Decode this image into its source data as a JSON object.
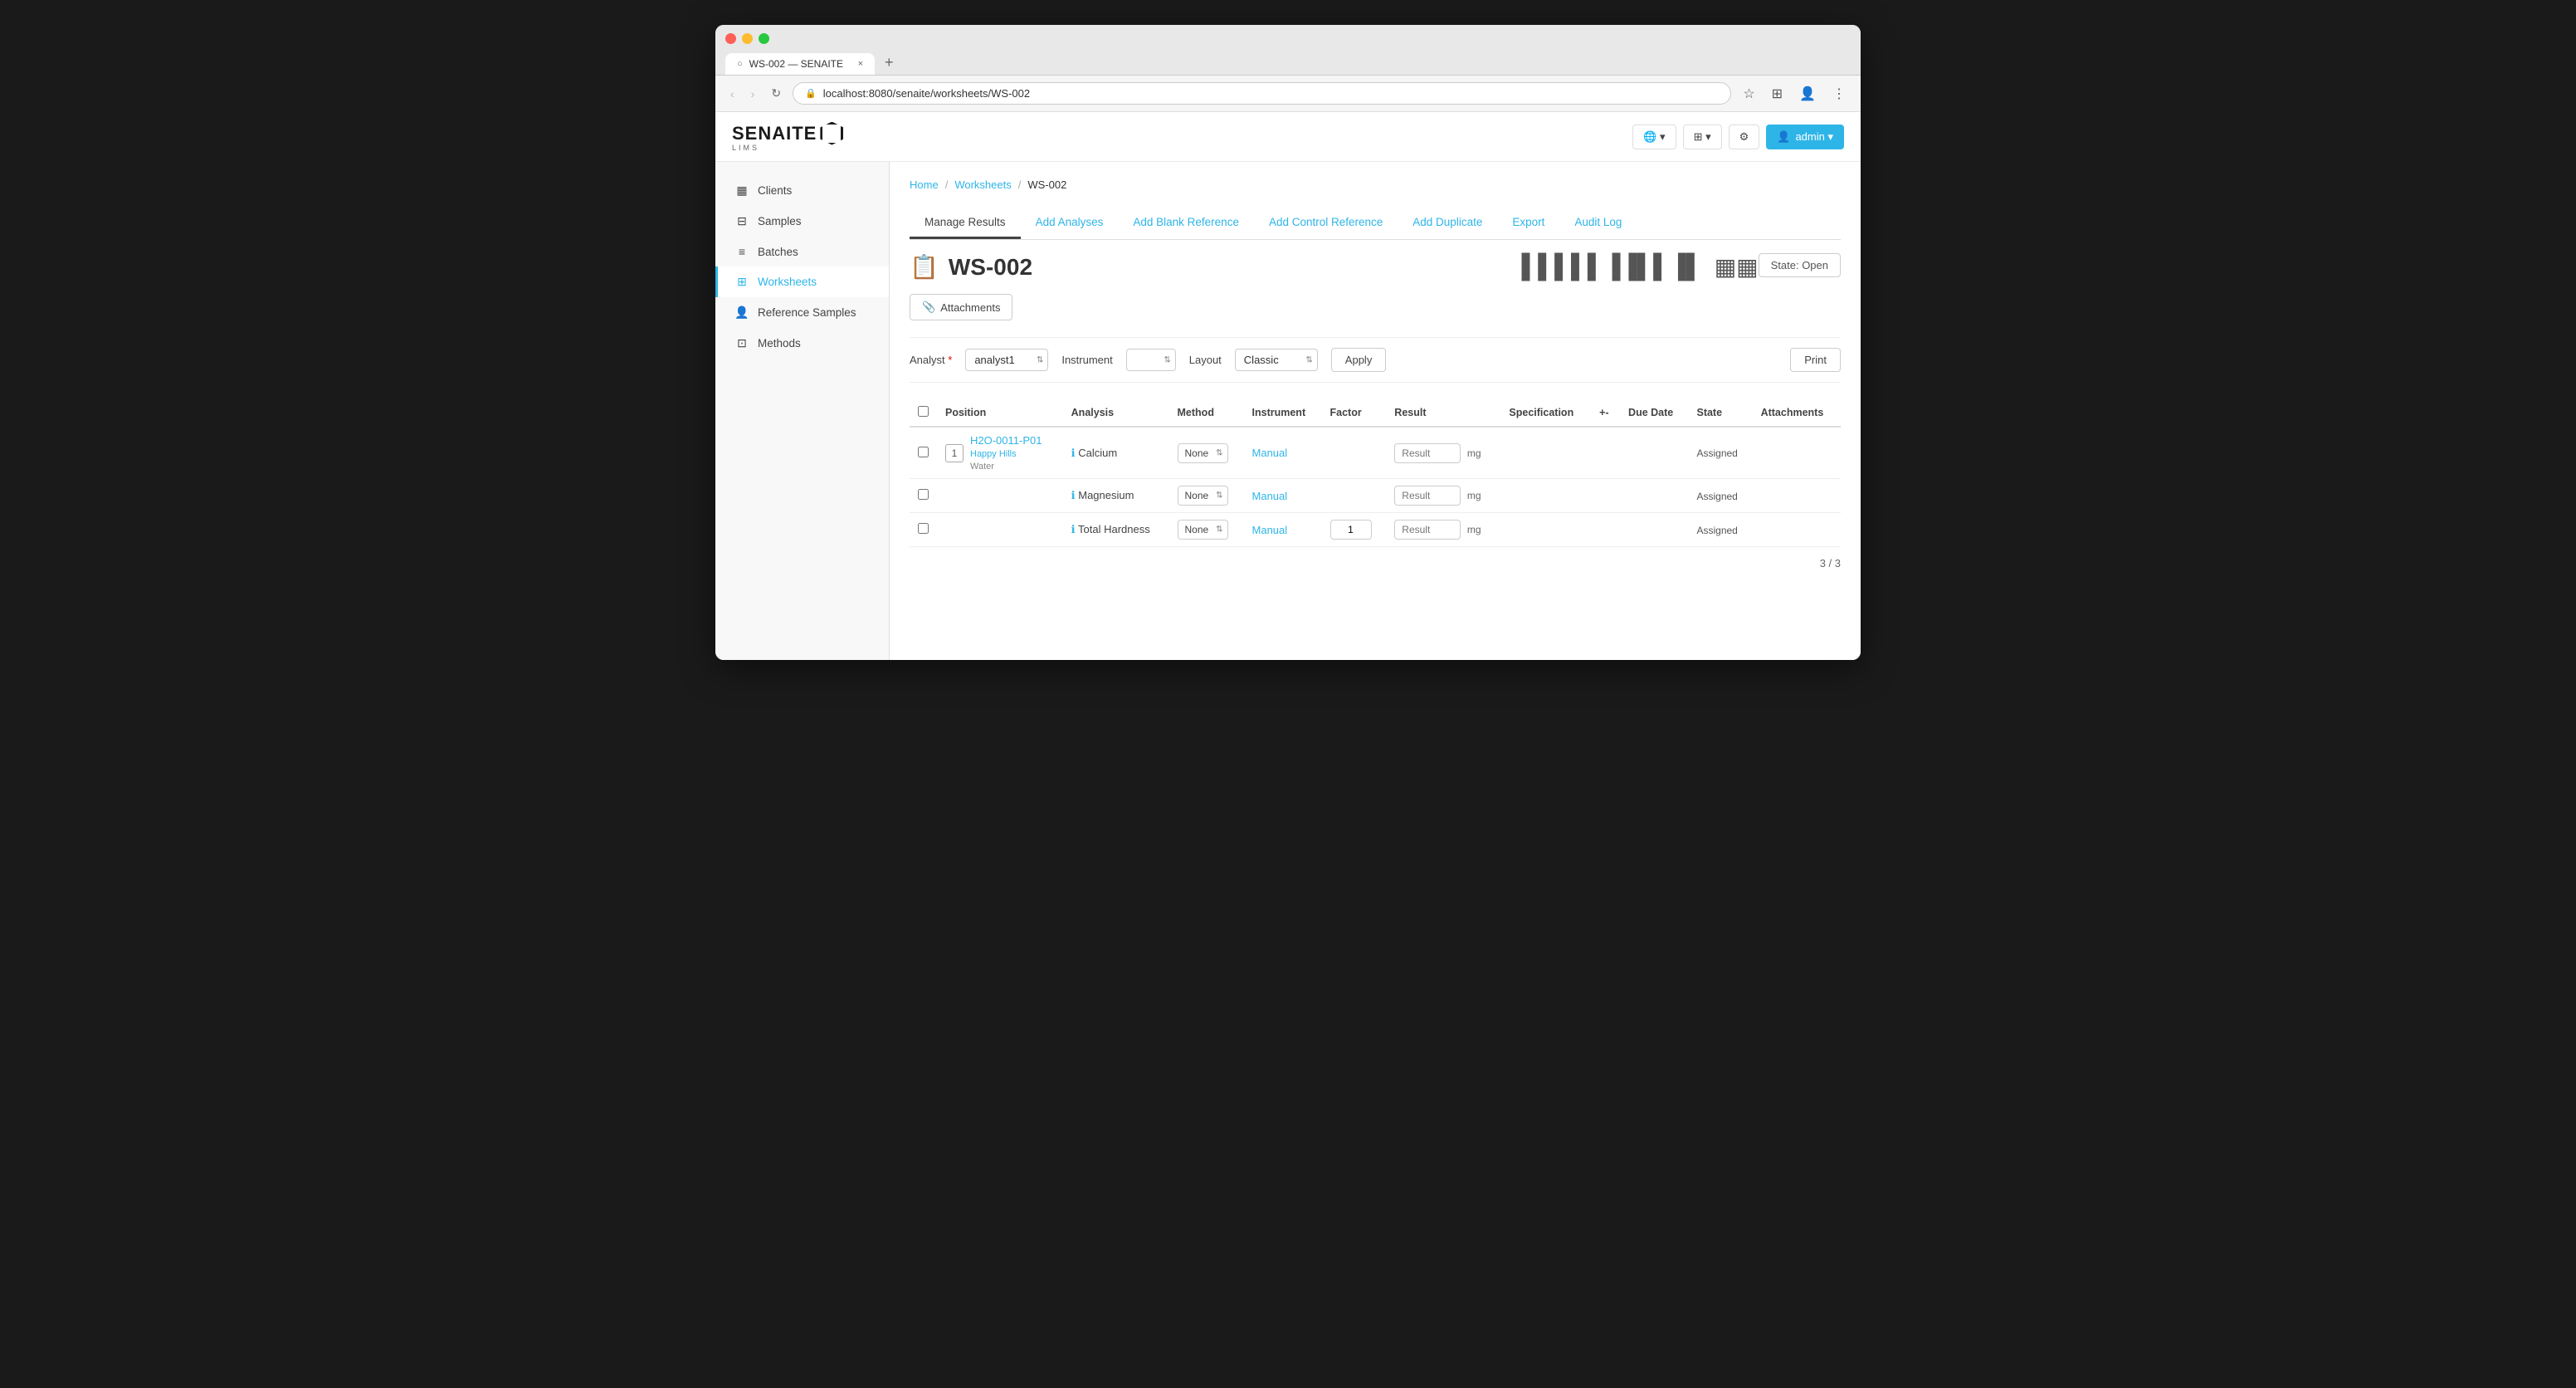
{
  "browser": {
    "tab_title": "WS-002 — SENAITE",
    "url": "localhost:8080/senaite/worksheets/WS-002",
    "new_tab_label": "+",
    "close_tab": "×"
  },
  "header": {
    "logo_text": "SENAITE",
    "logo_sub": "LIMS",
    "globe_btn": "🌐",
    "grid_btn": "⊞",
    "settings_btn": "⚙",
    "user_btn": "admin ▾"
  },
  "sidebar": {
    "items": [
      {
        "id": "clients",
        "label": "Clients",
        "icon": "▦"
      },
      {
        "id": "samples",
        "label": "Samples",
        "icon": "⊟"
      },
      {
        "id": "batches",
        "label": "Batches",
        "icon": "≡"
      },
      {
        "id": "worksheets",
        "label": "Worksheets",
        "icon": "⊞",
        "active": true
      },
      {
        "id": "reference-samples",
        "label": "Reference Samples",
        "icon": "👤"
      },
      {
        "id": "methods",
        "label": "Methods",
        "icon": "⊡"
      }
    ]
  },
  "breadcrumb": {
    "home": "Home",
    "worksheets": "Worksheets",
    "current": "WS-002"
  },
  "tabs": [
    {
      "id": "manage-results",
      "label": "Manage Results",
      "active": true
    },
    {
      "id": "add-analyses",
      "label": "Add Analyses"
    },
    {
      "id": "add-blank-reference",
      "label": "Add Blank Reference"
    },
    {
      "id": "add-control-reference",
      "label": "Add Control Reference"
    },
    {
      "id": "add-duplicate",
      "label": "Add Duplicate"
    },
    {
      "id": "export",
      "label": "Export"
    },
    {
      "id": "audit-log",
      "label": "Audit Log"
    }
  ],
  "worksheet": {
    "state_label": "State: Open",
    "title": "WS-002",
    "attachments_btn": "📎 Attachments"
  },
  "form": {
    "analyst_label": "Analyst",
    "analyst_required": "*",
    "analyst_value": "analyst1",
    "instrument_label": "Instrument",
    "layout_label": "Layout",
    "layout_value": "Classic",
    "apply_btn": "Apply",
    "print_btn": "Print"
  },
  "table": {
    "columns": [
      {
        "id": "select",
        "label": ""
      },
      {
        "id": "position",
        "label": "Position"
      },
      {
        "id": "analysis",
        "label": "Analysis"
      },
      {
        "id": "method",
        "label": "Method"
      },
      {
        "id": "instrument",
        "label": "Instrument"
      },
      {
        "id": "factor",
        "label": "Factor"
      },
      {
        "id": "result",
        "label": "Result"
      },
      {
        "id": "specification",
        "label": "Specification"
      },
      {
        "id": "plus-minus",
        "label": "+-"
      },
      {
        "id": "due-date",
        "label": "Due Date"
      },
      {
        "id": "state",
        "label": "State"
      },
      {
        "id": "attachments",
        "label": "Attachments"
      }
    ],
    "rows": [
      {
        "position": "1",
        "sample_id": "H2O-0011-P01",
        "sample_client": "Happy Hills",
        "sample_type": "Water",
        "analyses": [
          {
            "name": "Calcium",
            "method_value": "None",
            "instrument": "Manual",
            "factor": "",
            "result_placeholder": "Result",
            "unit": "mg",
            "state": "Assigned"
          },
          {
            "name": "Magnesium",
            "method_value": "None",
            "instrument": "Manual",
            "factor": "",
            "result_placeholder": "Result",
            "unit": "mg",
            "state": "Assigned"
          },
          {
            "name": "Total Hardness",
            "method_value": "None",
            "instrument": "Manual",
            "factor": "1",
            "result_placeholder": "Result",
            "unit": "mg",
            "state": "Assigned"
          }
        ]
      }
    ],
    "pagination": "3 / 3"
  }
}
